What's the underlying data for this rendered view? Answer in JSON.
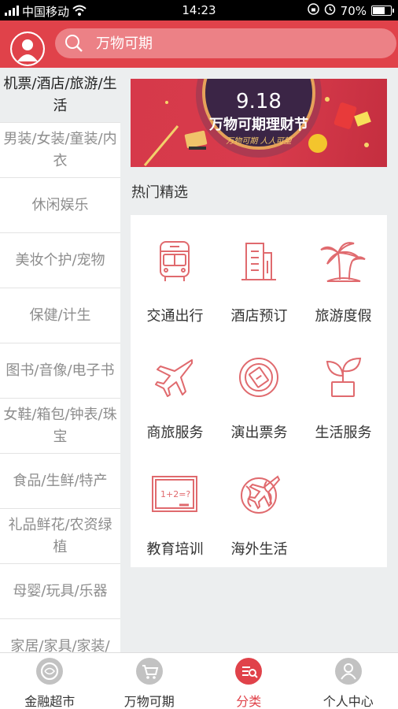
{
  "status_bar": {
    "carrier": "中国移动",
    "time": "14:23",
    "battery": "70%",
    "battery_level": 0.7
  },
  "header": {
    "search_placeholder": "万物可期",
    "avatar_icon": "user-avatar-icon"
  },
  "sidebar": {
    "items": [
      {
        "label": "机票/酒店/旅游/生活",
        "active": true
      },
      {
        "label": "男装/女装/童装/内衣"
      },
      {
        "label": "休闲娱乐"
      },
      {
        "label": "美妆个护/宠物"
      },
      {
        "label": "保健/计生"
      },
      {
        "label": "图书/音像/电子书"
      },
      {
        "label": "女鞋/箱包/钟表/珠宝"
      },
      {
        "label": "食品/生鲜/特产"
      },
      {
        "label": "礼品鲜花/农资绿植"
      },
      {
        "label": "母婴/玩具/乐器"
      },
      {
        "label": "家居/家具/家装/"
      }
    ]
  },
  "banner": {
    "date": "9.18",
    "title": "万物可期理财节",
    "subtitle": "万物可期 人人可望"
  },
  "section": {
    "title": "热门精选"
  },
  "categories": [
    {
      "label": "交通出行",
      "icon": "bus-icon"
    },
    {
      "label": "酒店预订",
      "icon": "hotel-icon"
    },
    {
      "label": "旅游度假",
      "icon": "palm-tree-icon"
    },
    {
      "label": "商旅服务",
      "icon": "airplane-icon"
    },
    {
      "label": "演出票务",
      "icon": "ticket-icon"
    },
    {
      "label": "生活服务",
      "icon": "plant-icon"
    },
    {
      "label": "教育培训",
      "icon": "blackboard-icon",
      "board_text": "1+2=?"
    },
    {
      "label": "海外生活",
      "icon": "globe-plane-icon"
    }
  ],
  "tabbar": {
    "tabs": [
      {
        "label": "金融超市",
        "icon": "finance-icon"
      },
      {
        "label": "万物可期",
        "icon": "cart-icon"
      },
      {
        "label": "分类",
        "icon": "category-icon",
        "active": true
      },
      {
        "label": "个人中心",
        "icon": "person-icon"
      }
    ]
  },
  "colors": {
    "accent": "#e0424a",
    "icon_stroke": "#e06a6e"
  }
}
